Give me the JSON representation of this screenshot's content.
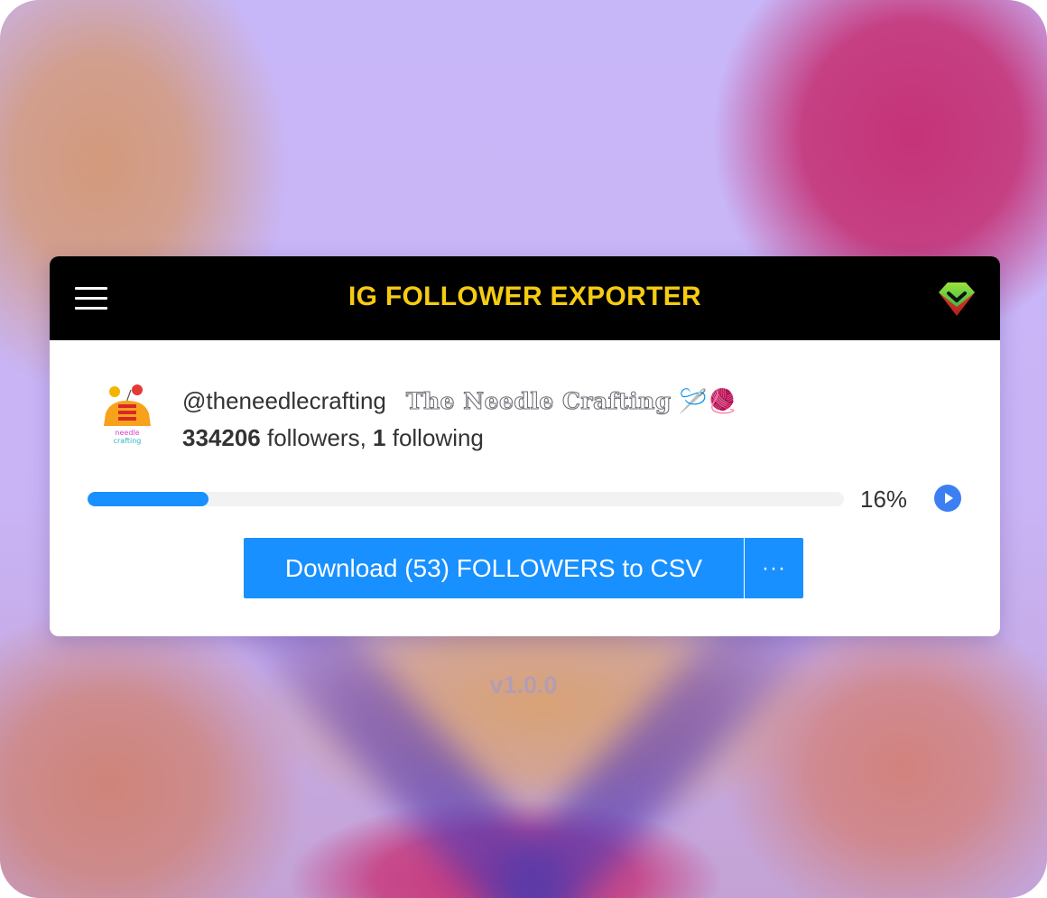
{
  "app": {
    "title": "IG FOLLOWER EXPORTER",
    "version": "v1.0.0",
    "colors": {
      "header_bg": "#000000",
      "title": "#f5cc12",
      "accent": "#1890ff",
      "play_button": "#3b7ff2"
    }
  },
  "header": {
    "menu_icon": "hamburger-menu-icon",
    "premium_icon": "gem-icon"
  },
  "profile": {
    "avatar": "avatar",
    "username": "@theneedlecrafting",
    "display_name": "The Needle Crafting",
    "display_name_emoji": "🪡🧶",
    "followers_count": "334206",
    "followers_label": " followers, ",
    "following_count": "1",
    "following_label": " following"
  },
  "progress": {
    "percent": 16,
    "label": "16%",
    "play_icon": "play-icon"
  },
  "actions": {
    "download_label": "Download (53) FOLLOWERS to CSV",
    "more_label": "···"
  }
}
